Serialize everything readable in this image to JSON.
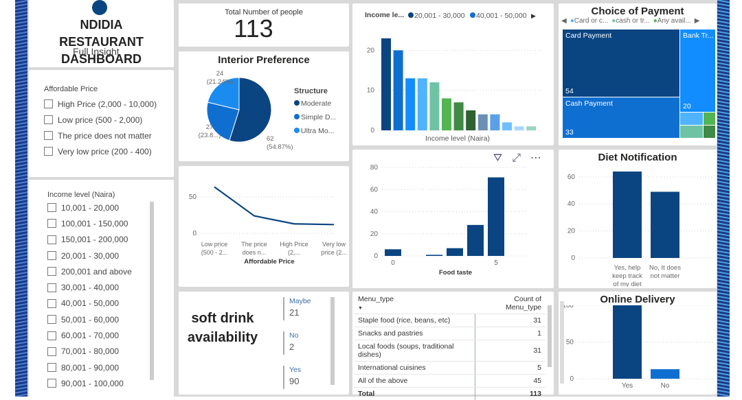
{
  "header": {
    "title": "NDIDIA RESTAURANT DASHBOARD",
    "subtitle": "Full Insight"
  },
  "affordable_slicer": {
    "title": "Affordable Price",
    "items": [
      "High Price (2,000 - 10,000)",
      "Low price (500 - 2,000)",
      "The price does not matter",
      "Very low price (200 - 400)"
    ]
  },
  "income_slicer": {
    "title": "Income level (Naira)",
    "items": [
      "10,001 - 20,000",
      "100,001 - 150,000",
      "150,001 - 200,000",
      "20,001 - 30,000",
      "200,001 and above",
      "30,001 - 40,000",
      "40,001 - 50,000",
      "50,001 - 60,000",
      "60,001 - 70,000",
      "70,001 - 80,000",
      "80,001 - 90,000",
      "90,001 - 100,000"
    ]
  },
  "total_card": {
    "label": "Total Number of people",
    "value": "113"
  },
  "soft_drink": {
    "title": "soft drink availability",
    "items": [
      {
        "label": "Maybe",
        "value": "21"
      },
      {
        "label": "No",
        "value": "2"
      },
      {
        "label": "Yes",
        "value": "90"
      }
    ]
  },
  "menu_table": {
    "headers": [
      "Menu_type",
      "Count of Menu_type"
    ],
    "rows": [
      [
        "Staple food (rice, beans, etc)",
        "31"
      ],
      [
        "Snacks and pastries",
        "1"
      ],
      [
        "Local foods (soups, traditional dishes)",
        "31"
      ],
      [
        "International cuisines",
        "5"
      ],
      [
        "All of the above",
        "45"
      ]
    ],
    "total": [
      "Total",
      "113"
    ]
  },
  "visual_header_icons": [
    "filter-icon",
    "focus-mode-icon",
    "more-options-icon"
  ],
  "chart_data": [
    {
      "id": "interior",
      "type": "pie",
      "title": "Interior Preference",
      "legend_title": "Structure",
      "legend": [
        "Moderate",
        "Simple D...",
        "Ultra Mo..."
      ],
      "values": [
        62,
        27,
        24
      ],
      "labels": [
        "62\n(54.87%)",
        "27\n(23.8...)",
        "24\n(21.24%)"
      ],
      "colors": [
        "#0a4582",
        "#0f6fd1",
        "#1a8cf0"
      ],
      "legend_placement": "right"
    },
    {
      "id": "income",
      "type": "bar",
      "legend_title": "Income le...",
      "legend": [
        "20,001 - 30,000",
        "40,001 - 50,000"
      ],
      "xlabel": "Income level (Naira)",
      "values": [
        23,
        20,
        13,
        13,
        12,
        8,
        7,
        5,
        4,
        4,
        2,
        1,
        1
      ],
      "colors": [
        "#0a4582",
        "#0f6fd1",
        "#118dff",
        "#4fb3ff",
        "#6fc3a5",
        "#52b552",
        "#3f8a46",
        "#2e6231",
        "#6b8fb5",
        "#5aa0e8",
        "#6fbfff",
        "#a8d8ff",
        "#9ad6c0"
      ],
      "ylim": [
        0,
        24
      ],
      "yticks": [
        0,
        10,
        20
      ],
      "grid": true
    },
    {
      "id": "payment",
      "type": "treemap",
      "title": "Choice of Payment",
      "legend": [
        "Card or c...",
        "cash or tr...",
        "Any avail..."
      ],
      "legend_colors": [
        "#4fb3ff",
        "#6fc3a5",
        "#52b552"
      ],
      "items": [
        {
          "label": "Card Payment",
          "value": 54,
          "color": "#0a4582"
        },
        {
          "label": "Cash Payment",
          "value": 33,
          "color": "#0f6fd1"
        },
        {
          "label": "Bank Tr...",
          "value": 20,
          "color": "#118dff"
        }
      ]
    },
    {
      "id": "affordable",
      "type": "line",
      "xlabel": "Affordable Price",
      "categories": [
        "Low price (500 - 2...",
        "The price does n...",
        "High Price (2,...",
        "Very low price (2..."
      ],
      "values": [
        64,
        24,
        13,
        12
      ],
      "ylim": [
        0,
        70
      ],
      "yticks": [
        0,
        50
      ],
      "color": "#0a4582",
      "grid": true
    },
    {
      "id": "food",
      "type": "bar",
      "xlabel": "Food taste",
      "x": [
        0,
        2,
        3,
        4,
        5
      ],
      "values": [
        6,
        1,
        7,
        28,
        71
      ],
      "xticks": [
        0,
        5
      ],
      "ylim": [
        0,
        80
      ],
      "yticks": [
        0,
        20,
        40,
        60,
        80
      ],
      "color": "#0a4582",
      "grid": true
    },
    {
      "id": "diet",
      "type": "bar",
      "title": "Diet Notification",
      "categories": [
        "Yes, help keep track of my diet",
        "No, It does not matter"
      ],
      "values": [
        64,
        49
      ],
      "ylim": [
        0,
        65
      ],
      "yticks": [
        0,
        20,
        40,
        60
      ],
      "color": "#0a4582",
      "grid": true
    },
    {
      "id": "delivery",
      "type": "bar",
      "title": "Online Delivery",
      "categories": [
        "Yes",
        "No"
      ],
      "values": [
        100,
        13
      ],
      "ylim": [
        0,
        100
      ],
      "yticks": [
        0,
        50,
        100
      ],
      "colors": [
        "#0a4582",
        "#0f6fd1"
      ],
      "grid": true
    }
  ]
}
